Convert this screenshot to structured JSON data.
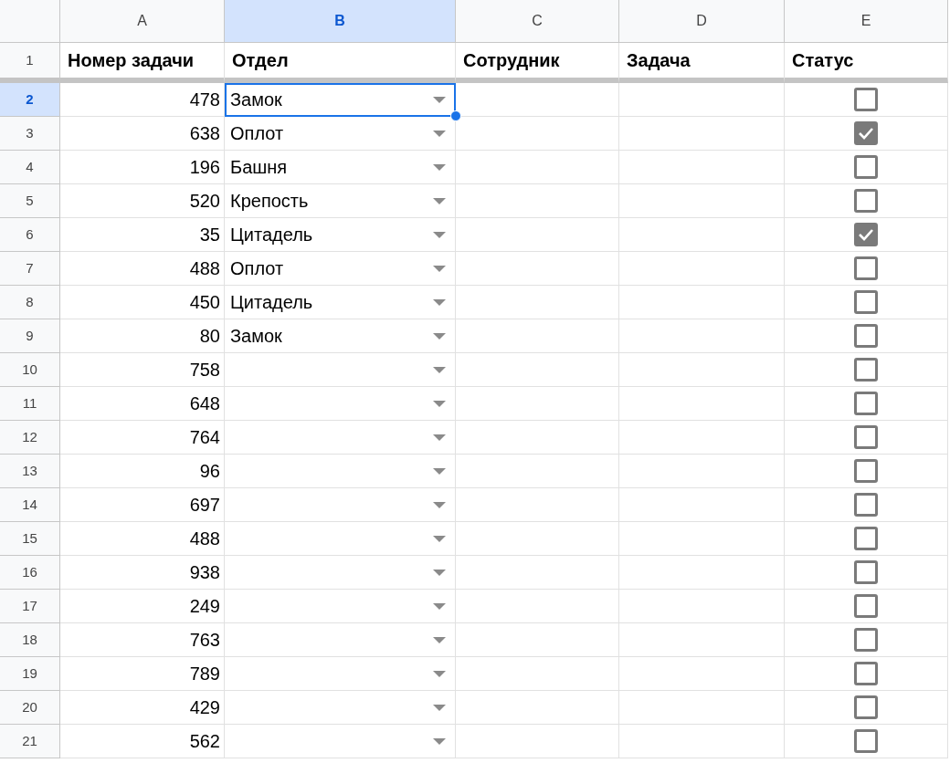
{
  "columns": [
    {
      "label": "A",
      "selected": false
    },
    {
      "label": "B",
      "selected": true
    },
    {
      "label": "C",
      "selected": false
    },
    {
      "label": "D",
      "selected": false
    },
    {
      "label": "E",
      "selected": false
    }
  ],
  "header_row": {
    "number": "1",
    "cells": [
      "Номер задачи",
      "Отдел",
      "Сотрудник",
      "Задача",
      "Статус"
    ]
  },
  "rows": [
    {
      "number": "2",
      "selected": true,
      "task_number": "478",
      "department": "Замок",
      "checked": false
    },
    {
      "number": "3",
      "selected": false,
      "task_number": "638",
      "department": "Оплот",
      "checked": true
    },
    {
      "number": "4",
      "selected": false,
      "task_number": "196",
      "department": "Башня",
      "checked": false
    },
    {
      "number": "5",
      "selected": false,
      "task_number": "520",
      "department": "Крепость",
      "checked": false
    },
    {
      "number": "6",
      "selected": false,
      "task_number": "35",
      "department": "Цитадель",
      "checked": true
    },
    {
      "number": "7",
      "selected": false,
      "task_number": "488",
      "department": "Оплот",
      "checked": false
    },
    {
      "number": "8",
      "selected": false,
      "task_number": "450",
      "department": "Цитадель",
      "checked": false
    },
    {
      "number": "9",
      "selected": false,
      "task_number": "80",
      "department": "Замок",
      "checked": false
    },
    {
      "number": "10",
      "selected": false,
      "task_number": "758",
      "checked": false
    },
    {
      "number": "11",
      "selected": false,
      "task_number": "648",
      "checked": false
    },
    {
      "number": "12",
      "selected": false,
      "task_number": "764",
      "checked": false
    },
    {
      "number": "13",
      "selected": false,
      "task_number": "96",
      "checked": false
    },
    {
      "number": "14",
      "selected": false,
      "task_number": "697",
      "checked": false
    },
    {
      "number": "15",
      "selected": false,
      "task_number": "488",
      "checked": false
    },
    {
      "number": "16",
      "selected": false,
      "task_number": "938",
      "checked": false
    },
    {
      "number": "17",
      "selected": false,
      "task_number": "249",
      "checked": false
    },
    {
      "number": "18",
      "selected": false,
      "task_number": "763",
      "checked": false
    },
    {
      "number": "19",
      "selected": false,
      "task_number": "789",
      "checked": false
    },
    {
      "number": "20",
      "selected": false,
      "task_number": "429",
      "checked": false
    },
    {
      "number": "21",
      "selected": false,
      "task_number": "562",
      "checked": false
    }
  ]
}
